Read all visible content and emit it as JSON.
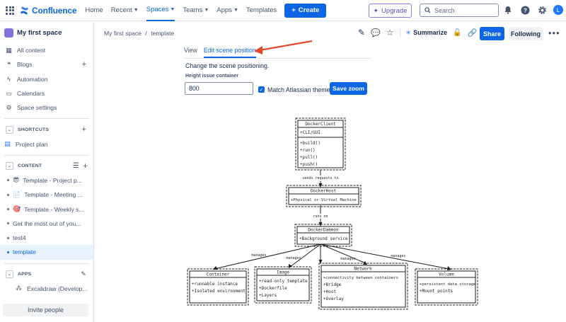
{
  "topbar": {
    "product": "Confluence",
    "nav": [
      {
        "label": "Home",
        "chevron": false,
        "active": false
      },
      {
        "label": "Recent",
        "chevron": true,
        "active": false
      },
      {
        "label": "Spaces",
        "chevron": true,
        "active": true
      },
      {
        "label": "Teams",
        "chevron": true,
        "active": false
      },
      {
        "label": "Apps",
        "chevron": true,
        "active": false
      },
      {
        "label": "Templates",
        "chevron": false,
        "active": false
      }
    ],
    "create_label": "Create",
    "upgrade_label": "Upgrade",
    "search_placeholder": "Search",
    "avatar_initial": "L"
  },
  "sidebar": {
    "space_name": "My first space",
    "items": [
      {
        "label": "All content",
        "icon": "grid-icon"
      },
      {
        "label": "Blogs",
        "icon": "blog-icon",
        "plus": true
      },
      {
        "label": "Automation",
        "icon": "bolt-icon"
      },
      {
        "label": "Calendars",
        "icon": "calendar-icon"
      },
      {
        "label": "Space settings",
        "icon": "gear-icon"
      }
    ],
    "shortcuts_label": "SHORTCUTS",
    "project_plan": "Project plan",
    "content_label": "CONTENT",
    "tree": [
      {
        "label": "Template - Project p...",
        "emoji": "😎"
      },
      {
        "label": "Template - Meeting ...",
        "emoji": "📄"
      },
      {
        "label": "Template - Weekly s...",
        "emoji": "🎯"
      },
      {
        "label": "Get the most out of you...",
        "emoji": ""
      },
      {
        "label": "test4",
        "emoji": ""
      },
      {
        "label": "template",
        "emoji": "",
        "selected": true
      }
    ],
    "apps_label": "APPS",
    "app_item": "Excalidraw (Develop...",
    "invite_label": "Invite people"
  },
  "page": {
    "breadcrumb_space": "My first space",
    "breadcrumb_sep": "/",
    "breadcrumb_page": "template",
    "summarize_label": "Summarize",
    "share_label": "Share",
    "following_label": "Following",
    "more_label": "•••"
  },
  "macro": {
    "tab_view": "View",
    "tab_edit": "Edit scene position",
    "description": "Change the scene positioning.",
    "height_label": "Height issue container",
    "height_value": "800",
    "match_theme_label": "Match Atlassian theme",
    "match_theme_checked": true,
    "save_zoom_label": "Save zoom"
  },
  "diagram": {
    "docker_client": {
      "title": "DockerClient",
      "attrs": [
        "+CLI/GUI"
      ],
      "methods": [
        "+build()",
        "+run()",
        "+pull()",
        "+push()"
      ]
    },
    "docker_host": {
      "title": "DockerHost",
      "attrs": [
        "+Physical or Virtual Machine"
      ]
    },
    "docker_daemon": {
      "title": "DockerDaemon",
      "attrs": [
        "+Background service"
      ]
    },
    "container": {
      "title": "Container",
      "attrs": [
        "+runnable instance",
        "+Isolated environment"
      ]
    },
    "image": {
      "title": "Image",
      "attrs": [
        "+read-only template",
        "+Dockerfile",
        "+Layers"
      ]
    },
    "network": {
      "title": "Network",
      "attrs": [
        "+connectivity between containers",
        "+Bridge",
        "+Host",
        "+Overlay"
      ]
    },
    "volume": {
      "title": "Volume",
      "attrs": [
        "+persistent data storage",
        "+Mount points"
      ]
    },
    "edge_sends": "sends requests to",
    "edge_runs": "runs on",
    "edge_manages": "manages"
  },
  "colors": {
    "accent": "#0c66e4",
    "annotation_arrow": "#e5492b"
  }
}
